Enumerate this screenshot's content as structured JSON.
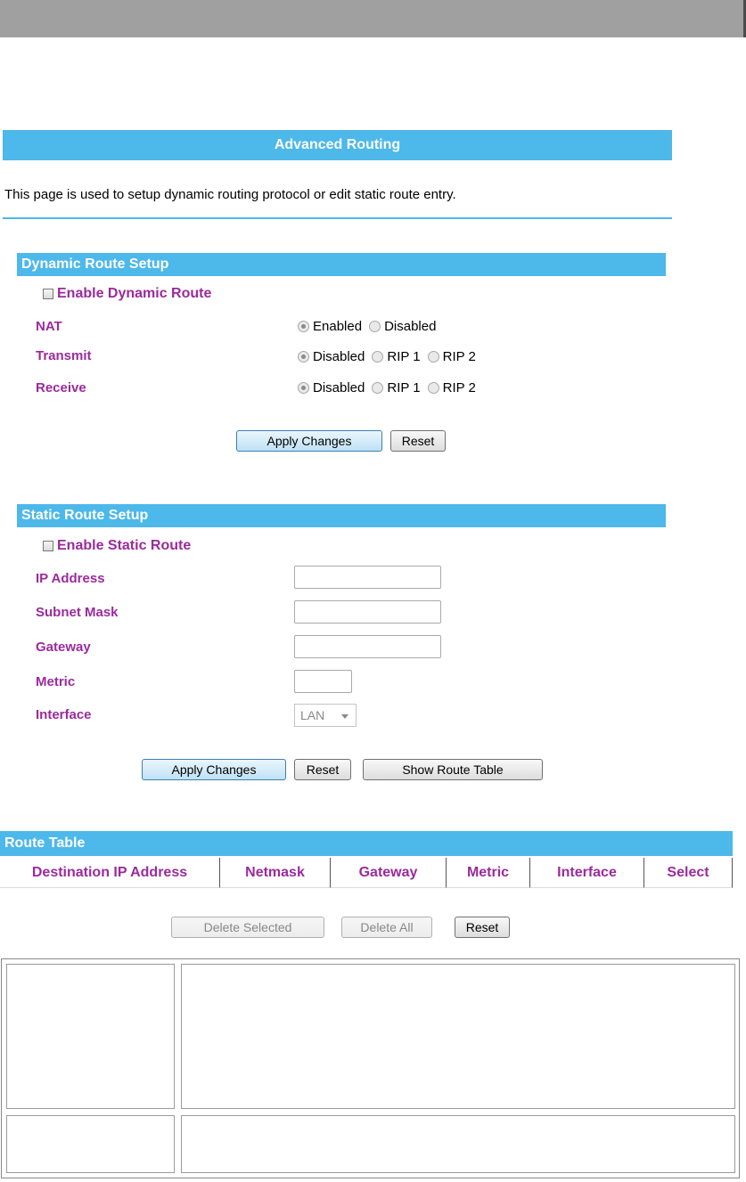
{
  "page": {
    "title": "Advanced Routing",
    "description": "This page is used to setup dynamic routing protocol or edit static route entry."
  },
  "dynamic": {
    "title": "Dynamic Route Setup",
    "enable_label": "Enable Dynamic Route",
    "nat": {
      "label": "NAT",
      "options": [
        "Enabled",
        "Disabled"
      ],
      "selected": "Enabled"
    },
    "transmit": {
      "label": "Transmit",
      "options": [
        "Disabled",
        "RIP 1",
        "RIP 2"
      ],
      "selected": "Disabled"
    },
    "receive": {
      "label": "Receive",
      "options": [
        "Disabled",
        "RIP 1",
        "RIP 2"
      ],
      "selected": "Disabled"
    },
    "apply_label": "Apply Changes",
    "reset_label": "Reset"
  },
  "static": {
    "title": "Static Route Setup",
    "enable_label": "Enable Static Route",
    "ip_label": "IP Address",
    "mask_label": "Subnet Mask",
    "gateway_label": "Gateway",
    "metric_label": "Metric",
    "interface_label": "Interface",
    "interface_value": "LAN",
    "apply_label": "Apply Changes",
    "reset_label": "Reset",
    "show_table_label": "Show Route Table"
  },
  "route_table": {
    "title": "Route Table",
    "columns": [
      "Destination IP Address",
      "Netmask",
      "Gateway",
      "Metric",
      "Interface",
      "Select"
    ],
    "delete_selected_label": "Delete Selected",
    "delete_all_label": "Delete All",
    "reset_label": "Reset"
  },
  "colors": {
    "accent": "#4db8ea",
    "label": "#9b2a9d",
    "topbar": "#a0a0a0"
  }
}
